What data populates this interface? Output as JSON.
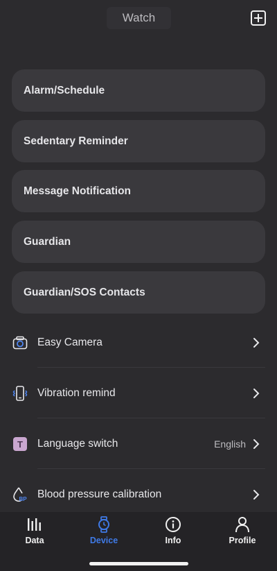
{
  "header": {
    "title": "Watch",
    "add_icon": "plus-square-icon"
  },
  "cards": [
    {
      "label": "Alarm/Schedule"
    },
    {
      "label": "Sedentary Reminder"
    },
    {
      "label": "Message Notification"
    },
    {
      "label": "Guardian"
    },
    {
      "label": "Guardian/SOS Contacts"
    }
  ],
  "rows": [
    {
      "label": "Easy Camera",
      "icon": "camera-icon",
      "value": ""
    },
    {
      "label": "Vibration remind",
      "icon": "vibration-phone-icon",
      "value": ""
    },
    {
      "label": "Language switch",
      "icon": "language-t-icon",
      "value": "English"
    },
    {
      "label": "Blood pressure calibration",
      "icon": "blood-pressure-icon",
      "value": ""
    }
  ],
  "tabs": [
    {
      "label": "Data",
      "icon": "bars-icon",
      "active": false
    },
    {
      "label": "Device",
      "icon": "watch-icon",
      "active": true
    },
    {
      "label": "Info",
      "icon": "info-icon",
      "active": false
    },
    {
      "label": "Profile",
      "icon": "person-icon",
      "active": false
    }
  ],
  "colors": {
    "background": "#2c2b2e",
    "card": "#3a393d",
    "accent": "#3f7ae6",
    "tabbar": "#242326"
  }
}
